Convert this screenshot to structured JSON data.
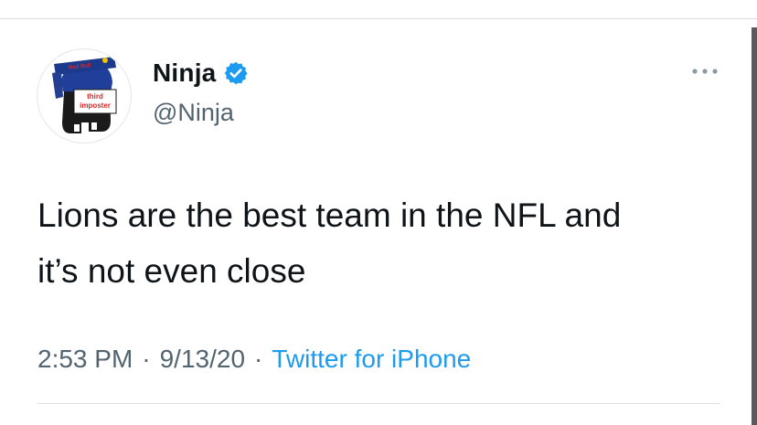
{
  "tweet": {
    "author": {
      "display_name": "Ninja",
      "handle": "@Ninja",
      "verified": true,
      "avatar_text": "third\nimposter"
    },
    "text": "Lions are the best team in the NFL and\nit’s not even close",
    "time": "2:53 PM",
    "date": "9/13/20",
    "separator": "·",
    "source": "Twitter for iPhone"
  },
  "icons": {
    "verified": "verified-badge-icon",
    "more": "more-options-icon"
  },
  "colors": {
    "link_blue": "#1d9bf0",
    "secondary_text": "#536471",
    "primary_text": "#0f1419"
  }
}
